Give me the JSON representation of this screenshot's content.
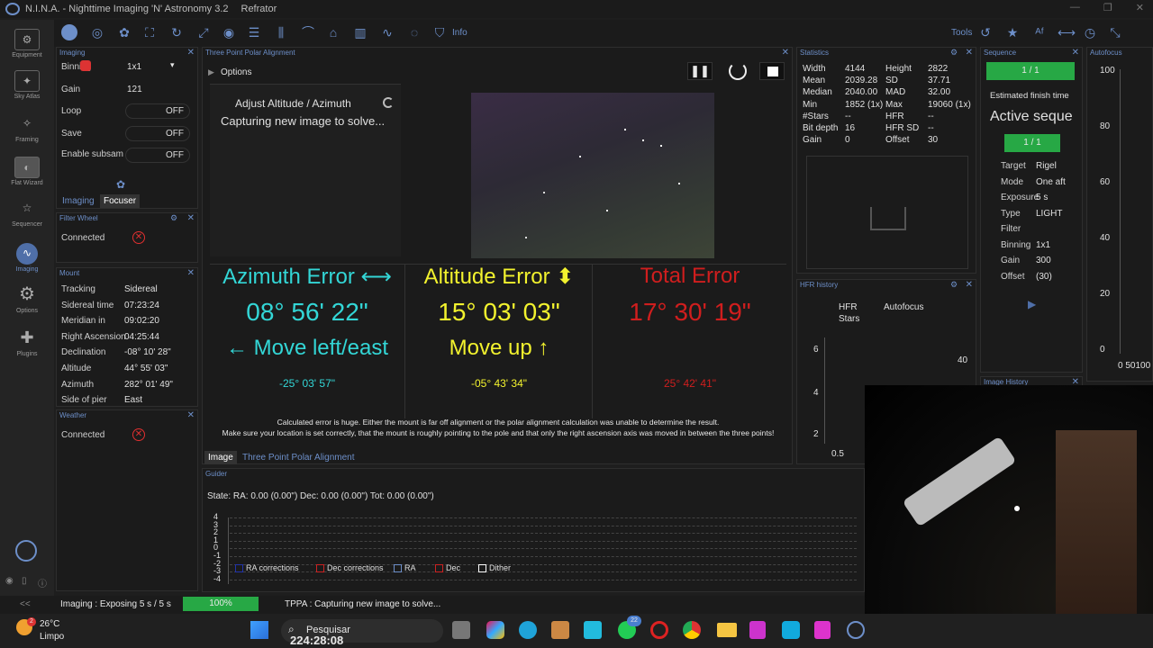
{
  "app": {
    "title": "N.I.N.A. - Nighttime Imaging 'N' Astronomy 3.2",
    "profile": "Refrator"
  },
  "toolbar": {
    "info": "Info",
    "tools": "Tools"
  },
  "nav": [
    "Equipment",
    "Sky Atlas",
    "Framing",
    "Flat Wizard",
    "Sequencer",
    "Imaging",
    "Options",
    "Plugins"
  ],
  "imaging_panel": {
    "title": "Imaging",
    "binning_label": "Binning",
    "binning_value": "1x1",
    "gain_label": "Gain",
    "gain_value": "121",
    "loop_label": "Loop",
    "loop_value": "OFF",
    "save_label": "Save",
    "save_value": "OFF",
    "subsample_label": "Enable subsam",
    "subsample_value": "OFF",
    "tab_imaging": "Imaging",
    "tab_focuser": "Focuser"
  },
  "filter_wheel": {
    "title": "Filter Wheel",
    "status": "Connected"
  },
  "mount": {
    "title": "Mount",
    "rows": [
      {
        "label": "Tracking",
        "value": "Sidereal"
      },
      {
        "label": "Sidereal time",
        "value": "07:23:24"
      },
      {
        "label": "Meridian in",
        "value": "09:02:20"
      },
      {
        "label": "Right Ascension",
        "value": "04:25:44"
      },
      {
        "label": "Declination",
        "value": "-08° 10' 28\""
      },
      {
        "label": "Altitude",
        "value": "44° 55' 03\""
      },
      {
        "label": "Azimuth",
        "value": "282° 01' 49\""
      },
      {
        "label": "Side of pier",
        "value": "East"
      }
    ]
  },
  "weather": {
    "title": "Weather",
    "status": "Connected"
  },
  "tppa": {
    "title": "Three Point Polar Alignment",
    "options": "Options",
    "step": "Adjust Altitude / Azimuth",
    "status": "Capturing new image to solve...",
    "azimuth": {
      "head": "Azimuth Error ⟷",
      "value": "08° 56' 22\"",
      "move": "← Move left/east",
      "detail": "-25° 03' 57\""
    },
    "altitude": {
      "head": "Altitude Error ⬍",
      "value": "15° 03' 03\"",
      "move": "Move up ↑",
      "detail": "-05° 43' 34\""
    },
    "total": {
      "head": "Total Error",
      "value": "17° 30' 19\"",
      "detail": "25° 42' 41\""
    },
    "warning1": "Calculated error is huge. Either the mount is far off alignment or the polar alignment calculation was unable to determine the result.",
    "warning2": "Make sure your location is set correctly, that the mount is roughly pointing to the pole and that only the right ascension axis was moved in between the three points!",
    "tab_image": "Image",
    "tab_tppa": "Three Point Polar Alignment"
  },
  "statistics": {
    "title": "Statistics",
    "rows": [
      [
        "Width",
        "4144",
        "Height",
        "2822"
      ],
      [
        "Mean",
        "2039.28",
        "SD",
        "37.71"
      ],
      [
        "Median",
        "2040.00",
        "MAD",
        "32.00"
      ],
      [
        "Min",
        "1852 (1x)",
        "Max",
        "19060 (1x)"
      ],
      [
        "#Stars",
        "--",
        "HFR",
        "--"
      ],
      [
        "Bit depth",
        "16",
        "HFR SD",
        "--"
      ],
      [
        "Gain",
        "0",
        "Offset",
        "30"
      ]
    ]
  },
  "hfr_history": {
    "title": "HFR history",
    "legend_hfr": "HFR",
    "legend_af": "Autofocus",
    "legend_stars": "Stars",
    "y_ticks": [
      "6",
      "4",
      "2"
    ],
    "y2_tick": "40",
    "x_tick": "0.5"
  },
  "sequence": {
    "title": "Sequence",
    "progress1": "1 / 1",
    "finish": "Estimated finish time",
    "active": "Active seque",
    "progress2": "1 / 1",
    "rows": [
      {
        "label": "Target",
        "value": "Rigel"
      },
      {
        "label": "Mode",
        "value": "One aft"
      },
      {
        "label": "Exposure",
        "value": "5 s"
      },
      {
        "label": "Type",
        "value": "LIGHT"
      },
      {
        "label": "Filter",
        "value": ""
      },
      {
        "label": "Binning",
        "value": "1x1"
      },
      {
        "label": "Gain",
        "value": "300"
      },
      {
        "label": "Offset",
        "value": "(30)"
      }
    ]
  },
  "image_history": {
    "title": "Image History"
  },
  "autofocus": {
    "title": "Autofocus",
    "y_ticks": [
      "100",
      "80",
      "60",
      "40",
      "20",
      "0"
    ],
    "x_ticks": "0 50100"
  },
  "guider": {
    "title": "Guider",
    "state": "State:  RA: 0.00 (0.00\")  Dec: 0.00 (0.00\")  Tot: 0.00 (0.00\")",
    "y_ticks": [
      "4",
      "3",
      "2",
      "1",
      "0",
      "-1",
      "-2",
      "-3",
      "-4"
    ],
    "legend": [
      "RA corrections",
      "Dec corrections",
      "RA",
      "Dec",
      "Dither"
    ]
  },
  "statusbar": {
    "imaging": "Imaging :  Exposing 5 s / 5 s",
    "progress": "100%",
    "tppa": "TPPA :  Capturing new image to solve..."
  },
  "taskbar": {
    "temp": "26°C",
    "weather": "Limpo",
    "search": "Pesquisar",
    "clock": "224:28:08",
    "badge": "22",
    "weather_badge": "2"
  },
  "colors": {
    "accent": "#6d8fc9",
    "azimuth": "#33d6d6",
    "altitude": "#f2f22e",
    "total": "#d01e1e",
    "progress": "#27a845"
  }
}
